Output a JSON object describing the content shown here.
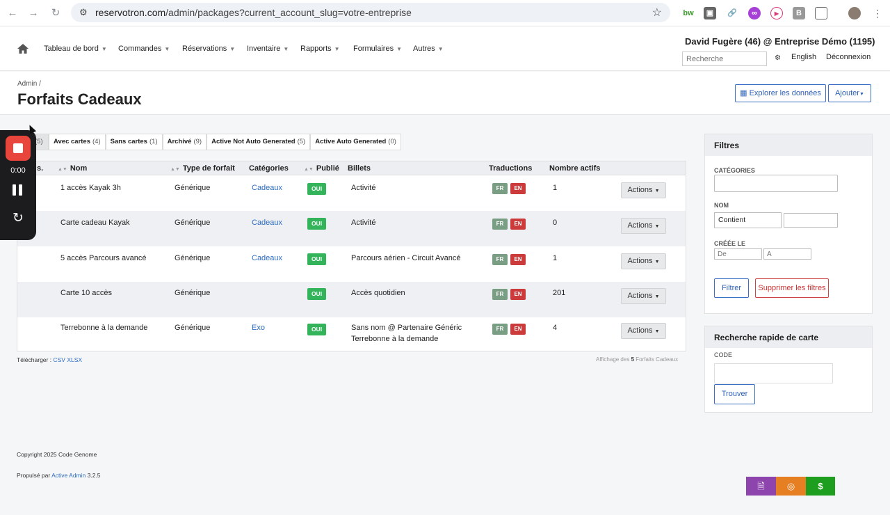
{
  "browser": {
    "url_host": "reservotron.com",
    "url_path": "/admin/packages?current_account_slug=votre-entreprise"
  },
  "nav": {
    "items": [
      "Tableau de bord",
      "Commandes",
      "Réservations",
      "Inventaire",
      "Rapports",
      "Formulaires",
      "Autres"
    ],
    "user": "David Fugère (46) @ Entreprise Démo (1195)",
    "search_placeholder": "Recherche",
    "language": "English",
    "logout": "Déconnexion"
  },
  "header": {
    "breadcrumb": "Admin",
    "breadcrumb_sep": "/",
    "title": "Forfaits Cadeaux",
    "explore_label": "Explorer les données",
    "add_label": "Ajouter"
  },
  "scopes": [
    {
      "label": "",
      "count": "(5)"
    },
    {
      "label": "Avec cartes",
      "count": "(4)"
    },
    {
      "label": "Sans cartes",
      "count": "(1)"
    },
    {
      "label": "Archivé",
      "count": "(9)"
    },
    {
      "label": "Active Not Auto Generated",
      "count": "(5)"
    },
    {
      "label": "Active Auto Generated",
      "count": "(0)"
    }
  ],
  "table": {
    "columns": [
      "s.",
      "Nom",
      "Type de forfait",
      "Catégories",
      "Publié",
      "Billets",
      "Traductions",
      "Nombre actifs"
    ],
    "rows": [
      {
        "nom": "1 accès Kayak 3h",
        "type": "Générique",
        "categorie": "Cadeaux",
        "publie": "OUI",
        "billets": "Activité",
        "billets2": "",
        "fr": "FR",
        "en": "EN",
        "actifs": "1",
        "actions": "Actions"
      },
      {
        "nom": "Carte cadeau Kayak",
        "type": "Générique",
        "categorie": "Cadeaux",
        "publie": "OUI",
        "billets": "Activité",
        "billets2": "",
        "fr": "FR",
        "en": "EN",
        "actifs": "0",
        "actions": "Actions"
      },
      {
        "nom": "5 accès Parcours avancé",
        "type": "Générique",
        "categorie": "Cadeaux",
        "publie": "OUI",
        "billets": "Parcours aérien - Circuit Avancé",
        "billets2": "",
        "fr": "FR",
        "en": "EN",
        "actifs": "1",
        "actions": "Actions"
      },
      {
        "nom": "Carte 10 accès",
        "type": "Générique",
        "categorie": "",
        "publie": "OUI",
        "billets": "Accès quotidien",
        "billets2": "",
        "fr": "FR",
        "en": "EN",
        "actifs": "201",
        "actions": "Actions"
      },
      {
        "nom": "Terrebonne à la demande",
        "type": "Générique",
        "categorie": "Exo",
        "publie": "OUI",
        "billets": "Sans nom @ Partenaire Généric",
        "billets2": "Terrebonne à la demande",
        "fr": "FR",
        "en": "EN",
        "actifs": "4",
        "actions": "Actions"
      }
    ]
  },
  "download": {
    "label": "Télécharger :",
    "csv": "CSV",
    "xlsx": "XLSX"
  },
  "pagination_info": {
    "prefix": "Affichage des",
    "count": "5",
    "suffix": "Forfaits Cadeaux"
  },
  "filters": {
    "title": "Filtres",
    "categories_label": "CATÉGORIES",
    "nom_label": "NOM",
    "nom_operator": "Contient",
    "created_label": "CRÉÉE LE",
    "from_placeholder": "De",
    "to_placeholder": "À",
    "filter_button": "Filtrer",
    "clear_button": "Supprimer les filtres"
  },
  "quick_search": {
    "title": "Recherche rapide de carte",
    "code_label": "CODE",
    "find_button": "Trouver"
  },
  "recorder": {
    "time": "0:00"
  },
  "footer": {
    "copyright": "Copyright 2025 Code Genome",
    "powered_prefix": "Propulsé par",
    "powered_link": "Active Admin",
    "version": "3.2.5"
  },
  "colors": {
    "published_green": "#33b35a",
    "fab_purple": "#8e44ad",
    "fab_orange": "#e67e22",
    "fab_green": "#1e9e1e"
  }
}
